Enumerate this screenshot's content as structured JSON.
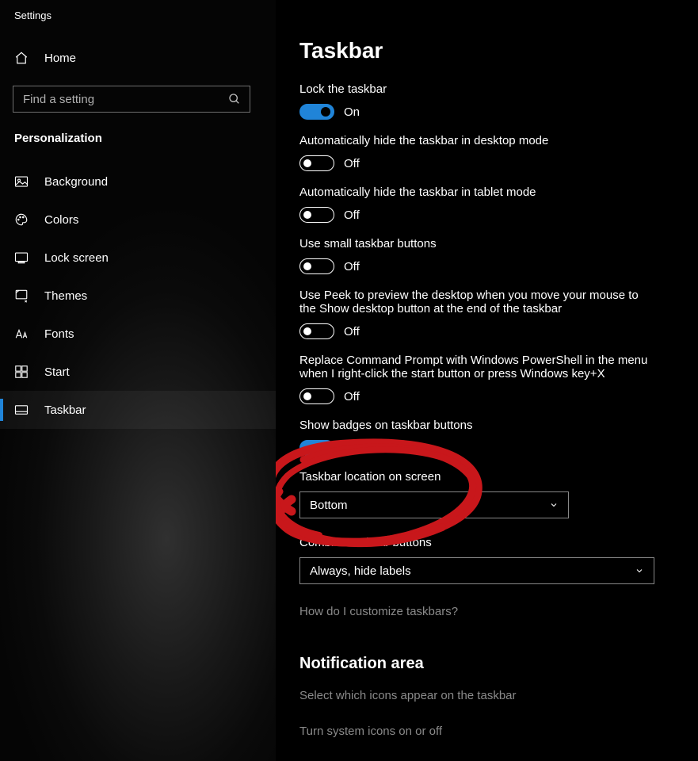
{
  "app_title": "Settings",
  "home_label": "Home",
  "search": {
    "placeholder": "Find a setting"
  },
  "section_title": "Personalization",
  "nav": [
    {
      "id": "background",
      "label": "Background",
      "selected": false
    },
    {
      "id": "colors",
      "label": "Colors",
      "selected": false
    },
    {
      "id": "lockscreen",
      "label": "Lock screen",
      "selected": false
    },
    {
      "id": "themes",
      "label": "Themes",
      "selected": false
    },
    {
      "id": "fonts",
      "label": "Fonts",
      "selected": false
    },
    {
      "id": "start",
      "label": "Start",
      "selected": false
    },
    {
      "id": "taskbar",
      "label": "Taskbar",
      "selected": true
    }
  ],
  "page": {
    "heading": "Taskbar",
    "toggles": [
      {
        "id": "lock",
        "label": "Lock the taskbar",
        "on": true
      },
      {
        "id": "autohide_dt",
        "label": "Automatically hide the taskbar in desktop mode",
        "on": false
      },
      {
        "id": "autohide_tb",
        "label": "Automatically hide the taskbar in tablet mode",
        "on": false
      },
      {
        "id": "small_btns",
        "label": "Use small taskbar buttons",
        "on": false
      },
      {
        "id": "peek",
        "label": "Use Peek to preview the desktop when you move your mouse to the Show desktop button at the end of the taskbar",
        "on": false
      },
      {
        "id": "powershell",
        "label": "Replace Command Prompt with Windows PowerShell in the menu when I right-click the start button or press Windows key+X",
        "on": false
      },
      {
        "id": "badges",
        "label": "Show badges on taskbar buttons",
        "on": true
      }
    ],
    "state_on": "On",
    "state_off": "Off",
    "location": {
      "label": "Taskbar location on screen",
      "value": "Bottom"
    },
    "combine": {
      "label": "Combine taskbar buttons",
      "value": "Always, hide labels"
    },
    "help_link": "How do I customize taskbars?",
    "notif_heading": "Notification area",
    "notif_links": [
      "Select which icons appear on the taskbar",
      "Turn system icons on or off"
    ]
  },
  "colors": {
    "accent": "#2084d8",
    "annotation": "#c8171b"
  }
}
